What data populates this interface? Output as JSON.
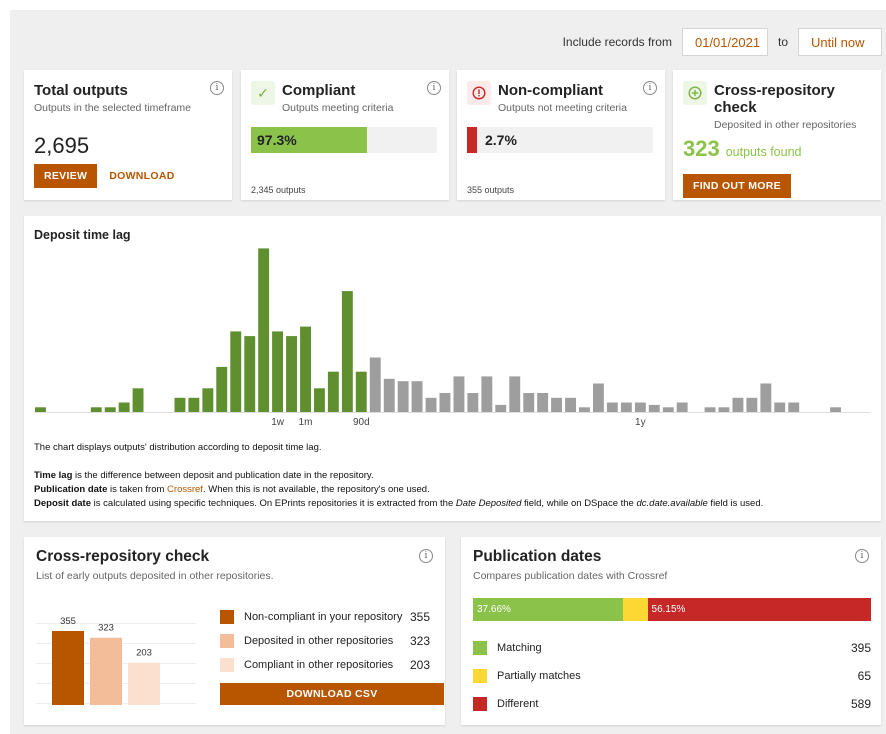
{
  "filter": {
    "label": "Include records from",
    "from": "01/01/2021",
    "to_label": "to",
    "to": "Until now"
  },
  "total": {
    "title": "Total outputs",
    "subtitle": "Outputs in the selected timeframe",
    "value": "2,695",
    "review": "REVIEW",
    "download": "DOWNLOAD"
  },
  "compliant": {
    "title": "Compliant",
    "subtitle": "Outputs meeting criteria",
    "percent_label": "97.3%",
    "percent": 97.3,
    "footer": "2,345 outputs",
    "color": "#8bc34a"
  },
  "noncompliant": {
    "title": "Non-compliant",
    "subtitle": "Outputs not meeting criteria",
    "percent_label": "2.7%",
    "percent": 2.7,
    "footer": "355 outputs",
    "color": "#c62828"
  },
  "crosscheck": {
    "title": "Cross-repository check",
    "subtitle": "Deposited in other repositories",
    "value": "323",
    "value_suffix": "outputs found",
    "button": "FIND OUT MORE",
    "color": "#8bc34a"
  },
  "lag": {
    "title": "Deposit time lag",
    "desc": "The chart displays outputs' distribution according to deposit time lag.",
    "line1_b": "Time lag",
    "line1": " is the difference between deposit and publication date in the repository.",
    "line2_b": "Publication date",
    "line2_a": " is taken from ",
    "line2_link": "Crossref",
    "line2_c": ". When this is not available, the repository's one used.",
    "line3_b": "Deposit date",
    "line3_a": " is calculated using specific techniques. On EPrints repositories it is extracted from the ",
    "line3_i1": "Date Deposited",
    "line3_c": " field, while on DSpace the ",
    "line3_i2": "dc.date.available",
    "line3_d": " field is used."
  },
  "chart_data": {
    "type": "bar",
    "tick_labels": [
      {
        "index": 17,
        "label": "1w"
      },
      {
        "index": 19,
        "label": "1m"
      },
      {
        "index": 23,
        "label": "90d"
      },
      {
        "index": 43,
        "label": "1y"
      }
    ],
    "ymax": 140,
    "colors": {
      "compliant": "#5f8f2e",
      "late": "#9e9e9e"
    },
    "green_until_index": 23,
    "values": [
      4,
      0,
      0,
      0,
      4,
      4,
      8,
      20,
      0,
      0,
      12,
      12,
      20,
      38,
      68,
      64,
      138,
      68,
      64,
      72,
      20,
      34,
      102,
      34,
      46,
      28,
      26,
      26,
      12,
      16,
      30,
      16,
      30,
      6,
      30,
      16,
      16,
      12,
      12,
      4,
      24,
      8,
      8,
      8,
      6,
      4,
      8,
      0,
      4,
      4,
      12,
      12,
      24,
      8,
      8,
      0,
      0,
      4
    ]
  },
  "cross": {
    "title": "Cross-repository check",
    "subtitle": "List of early outputs deposited in other repositories.",
    "bars": [
      {
        "label": "Non-compliant in your repository",
        "value": 355,
        "color": "#b85600"
      },
      {
        "label": "Deposited in other repositories",
        "value": 323,
        "color": "#f4bd9a"
      },
      {
        "label": "Compliant in other repositories",
        "value": 203,
        "color": "#fbe0d0"
      }
    ],
    "button": "DOWNLOAD CSV"
  },
  "pub": {
    "title": "Publication dates",
    "subtitle": "Compares publication dates with Crossref",
    "segments": [
      {
        "label": "Matching",
        "value": 395,
        "percent_label": "37.66%",
        "color": "#8bc34a"
      },
      {
        "label": "Partially matches",
        "value": 65,
        "percent_label": "",
        "color": "#fdd835"
      },
      {
        "label": "Different",
        "value": 589,
        "percent_label": "56.15%",
        "color": "#c62828"
      }
    ]
  }
}
